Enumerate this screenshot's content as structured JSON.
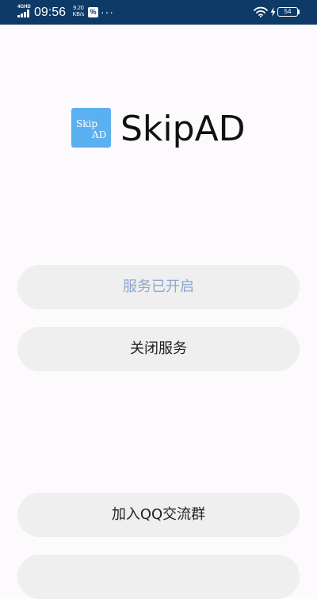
{
  "status_bar": {
    "network_label": "4GHD",
    "time": "09:56",
    "speed_value": "9.20",
    "speed_unit": "KB/s",
    "app_icon_glyph": "%",
    "more": "···",
    "icons": [
      "signal-icon",
      "wifi-icon",
      "charging-icon",
      "battery-icon"
    ],
    "battery_level": "54"
  },
  "app": {
    "logo_line1": "Skip",
    "logo_line2": "AD",
    "name": "SkipAD",
    "logo_color": "#5bb0ef"
  },
  "buttons": {
    "service_status": "服务已开启",
    "stop_service": "关闭服务",
    "join_qq_group": "加入QQ交流群"
  },
  "colors": {
    "status_bar_bg": "#0d3a66",
    "button_bg": "#efefef",
    "status_text": "#8fa6cf"
  }
}
